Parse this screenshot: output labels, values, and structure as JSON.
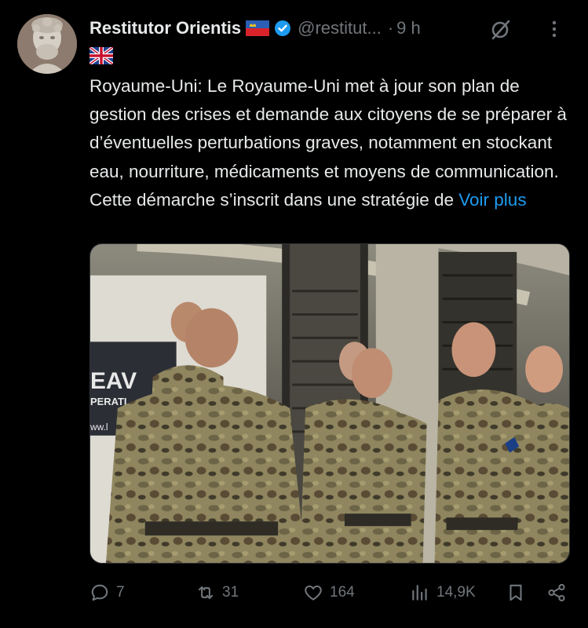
{
  "author": {
    "display_name": "Restitutor Orientis",
    "handle": "@restitut...",
    "time": "9 h",
    "separator": "·"
  },
  "flag_emojis": {
    "name_flag": "liechtenstein-flag",
    "post_flag": "uk-flag"
  },
  "tweet": {
    "text": "Royaume-Uni: Le Royaume-Uni met à jour son plan de gestion des crises et demande aux citoyens de se préparer à d’éventuelles perturbations graves, notamment en stockant eau, nourriture, médicaments et moyens de communication. Cette démarche s’inscrit dans une stratégie de",
    "show_more": "Voir plus"
  },
  "media": {
    "sign_text_1": "EAV",
    "sign_text_2": "PERATI",
    "sign_text_3": "ww.l"
  },
  "actions": {
    "replies": "7",
    "reposts": "31",
    "likes": "164",
    "views": "14,9K"
  },
  "colors": {
    "background": "#000000",
    "text": "#e7e9ea",
    "muted": "#71767b",
    "link": "#1d9bf0",
    "verified": "#1d9bf0"
  }
}
